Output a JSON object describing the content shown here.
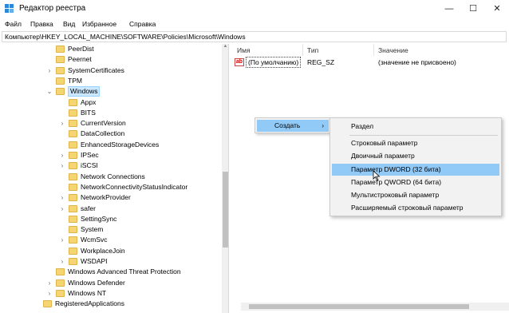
{
  "window": {
    "title": "Редактор реестра",
    "controls": [
      "—",
      "☐",
      "✕"
    ]
  },
  "menu": [
    "Файл",
    "Правка",
    "Вид",
    "Избранное",
    "Справка"
  ],
  "address": "Компьютер\\HKEY_LOCAL_MACHINE\\SOFTWARE\\Policies\\Microsoft\\Windows",
  "tree": [
    {
      "label": "PeerDist",
      "level": 1,
      "arrow": ""
    },
    {
      "label": "Peernet",
      "level": 1,
      "arrow": ""
    },
    {
      "label": "SystemCertificates",
      "level": 1,
      "arrow": "›"
    },
    {
      "label": "TPM",
      "level": 1,
      "arrow": ""
    },
    {
      "label": "Windows",
      "level": 1,
      "arrow": "⌄",
      "selected": true
    },
    {
      "label": "Appx",
      "level": 2,
      "arrow": ""
    },
    {
      "label": "BITS",
      "level": 2,
      "arrow": ""
    },
    {
      "label": "CurrentVersion",
      "level": 2,
      "arrow": "›"
    },
    {
      "label": "DataCollection",
      "level": 2,
      "arrow": ""
    },
    {
      "label": "EnhancedStorageDevices",
      "level": 2,
      "arrow": ""
    },
    {
      "label": "IPSec",
      "level": 2,
      "arrow": "›"
    },
    {
      "label": "iSCSI",
      "level": 2,
      "arrow": "›"
    },
    {
      "label": "Network Connections",
      "level": 2,
      "arrow": ""
    },
    {
      "label": "NetworkConnectivityStatusIndicator",
      "level": 2,
      "arrow": ""
    },
    {
      "label": "NetworkProvider",
      "level": 2,
      "arrow": "›"
    },
    {
      "label": "safer",
      "level": 2,
      "arrow": "›"
    },
    {
      "label": "SettingSync",
      "level": 2,
      "arrow": ""
    },
    {
      "label": "System",
      "level": 2,
      "arrow": ""
    },
    {
      "label": "WcmSvc",
      "level": 2,
      "arrow": "›"
    },
    {
      "label": "WorkplaceJoin",
      "level": 2,
      "arrow": ""
    },
    {
      "label": "WSDAPI",
      "level": 2,
      "arrow": "›"
    },
    {
      "label": "Windows Advanced Threat Protection",
      "level": 1,
      "arrow": ""
    },
    {
      "label": "Windows Defender",
      "level": 1,
      "arrow": "›"
    },
    {
      "label": "Windows NT",
      "level": 1,
      "arrow": "›"
    },
    {
      "label": "RegisteredApplications",
      "level": 0,
      "arrow": ""
    }
  ],
  "columns": {
    "name": "Имя",
    "type": "Тип",
    "value": "Значение"
  },
  "values": [
    {
      "name": "(По умолчанию)",
      "type": "REG_SZ",
      "data": "(значение не присвоено)",
      "icon": "ab"
    }
  ],
  "context_menu": {
    "create": "Создать",
    "arrow": "›"
  },
  "submenu": [
    "Раздел",
    "Строковый параметр",
    "Двоичный параметр",
    "Параметр DWORD (32 бита)",
    "Параметр QWORD (64 бита)",
    "Мультистроковый параметр",
    "Расширяемый строковый параметр"
  ]
}
